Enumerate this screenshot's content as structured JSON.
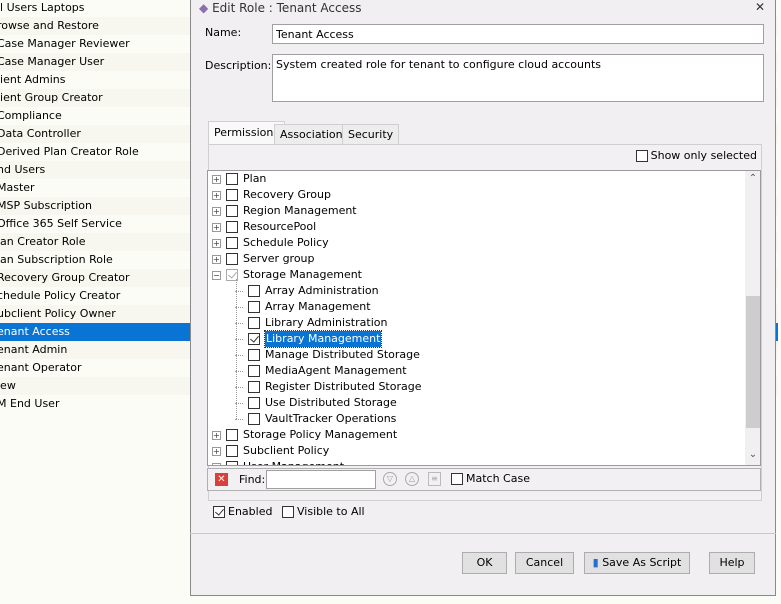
{
  "role_list": [
    "ll Users Laptops",
    "rowse and Restore",
    "Case Manager Reviewer",
    "Case Manager User",
    "lient Admins",
    "lient Group Creator",
    "Compliance",
    "Data Controller",
    "Derived Plan Creator Role",
    "nd Users",
    "Master",
    "MSP Subscription",
    "Office 365 Self Service",
    "lan Creator Role",
    "lan Subscription Role",
    "Recovery Group Creator",
    "chedule Policy Creator",
    "ubclient Policy Owner",
    "enant Access",
    "enant Admin",
    "enant Operator",
    "iew",
    "M End User"
  ],
  "selected_index": 18,
  "dialog": {
    "title": "Edit Role : Tenant Access",
    "name_label": "Name:",
    "name_value": "Tenant Access",
    "description_label": "Description:",
    "description_value": "System created role for tenant to configure cloud accounts"
  },
  "tabs": [
    "Permissions",
    "Associations",
    "Security"
  ],
  "show_only_selected": "Show only selected",
  "tree": [
    {
      "label": "Plan",
      "level": 0,
      "checked": false,
      "expandable": true
    },
    {
      "label": "Recovery Group",
      "level": 0,
      "checked": false,
      "expandable": true
    },
    {
      "label": "Region Management",
      "level": 0,
      "checked": false,
      "expandable": true
    },
    {
      "label": "ResourcePool",
      "level": 0,
      "checked": false,
      "expandable": true
    },
    {
      "label": "Schedule Policy",
      "level": 0,
      "checked": false,
      "expandable": true
    },
    {
      "label": "Server group",
      "level": 0,
      "checked": false,
      "expandable": true
    },
    {
      "label": "Storage Management",
      "level": 0,
      "checked": "partial",
      "expandable": true,
      "expanded": true
    },
    {
      "label": "Array Administration",
      "level": 1,
      "checked": false
    },
    {
      "label": "Array Management",
      "level": 1,
      "checked": false
    },
    {
      "label": "Library Administration",
      "level": 1,
      "checked": false
    },
    {
      "label": "Library Management",
      "level": 1,
      "checked": true,
      "selected": true
    },
    {
      "label": "Manage Distributed Storage",
      "level": 1,
      "checked": false
    },
    {
      "label": "MediaAgent Management",
      "level": 1,
      "checked": false
    },
    {
      "label": "Register Distributed Storage",
      "level": 1,
      "checked": false
    },
    {
      "label": "Use Distributed Storage",
      "level": 1,
      "checked": false
    },
    {
      "label": "VaultTracker Operations",
      "level": 1,
      "checked": false
    },
    {
      "label": "Storage Policy Management",
      "level": 0,
      "checked": false,
      "expandable": true
    },
    {
      "label": "Subclient Policy",
      "level": 0,
      "checked": false,
      "expandable": true
    },
    {
      "label": "User Management",
      "level": 0,
      "checked": false,
      "expandable": true
    }
  ],
  "find": {
    "label": "Find:",
    "value": "",
    "match_case": "Match Case"
  },
  "enabled": {
    "label": "Enabled",
    "checked": true
  },
  "visible_to_all": {
    "label": "Visible to All",
    "checked": false
  },
  "buttons": {
    "ok": "OK",
    "cancel": "Cancel",
    "save_as_script": "Save As Script",
    "help": "Help"
  }
}
